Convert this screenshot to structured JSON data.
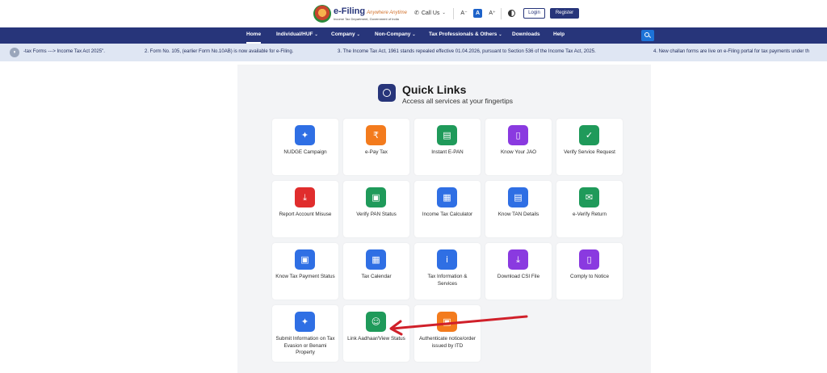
{
  "header": {
    "logo": {
      "title": "e-Filing",
      "tagline": "Anywhere Anytime",
      "subtitle": "Income Tax Department, Government of India"
    },
    "call_us": "Call Us",
    "font_small": "A⁻",
    "font_normal": "A",
    "font_large": "A⁺",
    "login_label": "Login",
    "register_label": "Register"
  },
  "nav": {
    "items": [
      {
        "label": "Home"
      },
      {
        "label": "Individual/HUF"
      },
      {
        "label": "Company"
      },
      {
        "label": "Non-Company"
      },
      {
        "label": "Tax Professionals & Others"
      },
      {
        "label": "Downloads"
      },
      {
        "label": "Help"
      }
    ]
  },
  "ticker": {
    "items": [
      "-tax Forms ---> Income Tax Act 2025\".",
      "2. Form No. 105, (earlier Form No.10AB) is now available for e-Filing.",
      "3. The Income Tax Act, 1961 stands repealed effective 01.04.2026, pursuant to Section 536 of the Income Tax Act, 2025.",
      "4. New challan forms are live on e-Filing portal for tax payments under th"
    ]
  },
  "quick_links": {
    "title": "Quick Links",
    "subtitle": "Access all services at your fingertips",
    "tiles": [
      {
        "label": "NUDGE Campaign",
        "icon": "megaphone-icon",
        "color": "#2f6fe4",
        "glyph": "✦"
      },
      {
        "label": "e-Pay Tax",
        "icon": "pay-tax-icon",
        "color": "#f37b1d",
        "glyph": "₹"
      },
      {
        "label": "Instant E-PAN",
        "icon": "e-pan-card-icon",
        "color": "#1f9a5a",
        "glyph": "▤"
      },
      {
        "label": "Know Your JAO",
        "icon": "document-user-icon",
        "color": "#8a3ae0",
        "glyph": "▯"
      },
      {
        "label": "Verify Service Request",
        "icon": "verify-check-icon",
        "color": "#1f9a5a",
        "glyph": "✓"
      },
      {
        "label": "Report Account Misuse",
        "icon": "download-report-icon",
        "color": "#e02d2d",
        "glyph": "⤓"
      },
      {
        "label": "Verify PAN Status",
        "icon": "pan-status-icon",
        "color": "#1f9a5a",
        "glyph": "▣"
      },
      {
        "label": "Income Tax Calculator",
        "icon": "calculator-icon",
        "color": "#2f6fe4",
        "glyph": "▦"
      },
      {
        "label": "Know TAN Details",
        "icon": "tan-details-icon",
        "color": "#2f6fe4",
        "glyph": "▤"
      },
      {
        "label": "e-Verify Return",
        "icon": "e-verify-envelope-icon",
        "color": "#1f9a5a",
        "glyph": "✉"
      },
      {
        "label": "Know Tax Payment Status",
        "icon": "payment-status-icon",
        "color": "#2f6fe4",
        "glyph": "▣"
      },
      {
        "label": "Tax Calendar",
        "icon": "calendar-icon",
        "color": "#2f6fe4",
        "glyph": "▦"
      },
      {
        "label": "Tax Information & Services",
        "icon": "info-icon",
        "color": "#2f6fe4",
        "glyph": "i"
      },
      {
        "label": "Download CSI File",
        "icon": "download-icon",
        "color": "#8a3ae0",
        "glyph": "⤓"
      },
      {
        "label": "Comply to Notice",
        "icon": "notice-document-icon",
        "color": "#8a3ae0",
        "glyph": "▯"
      },
      {
        "label": "Submit Information on Tax Evasion or Benami Property",
        "icon": "megaphone-icon",
        "color": "#2f6fe4",
        "glyph": "✦"
      },
      {
        "label": "Link Aadhaar/View Status",
        "icon": "user-link-icon",
        "color": "#1f9a5a",
        "glyph": "☺"
      },
      {
        "label": "Authenticate notice/order issued by ITD",
        "icon": "authenticate-icon",
        "color": "#f37b1d",
        "glyph": "▣"
      }
    ]
  },
  "annotation": {
    "arrow_color": "#d0202a"
  }
}
